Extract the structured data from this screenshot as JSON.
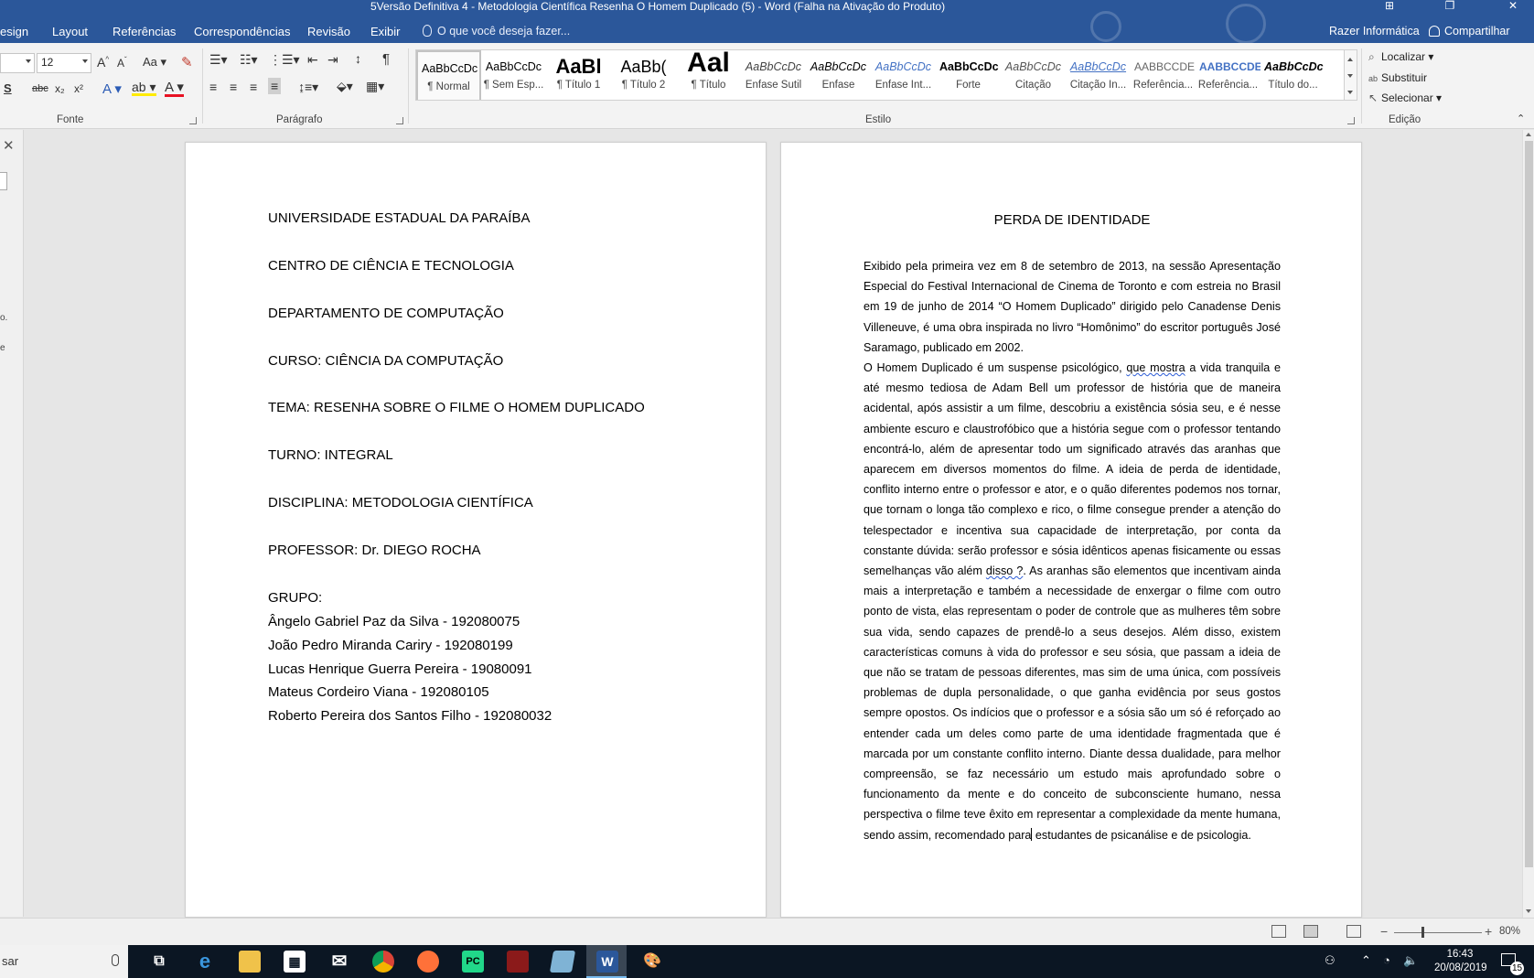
{
  "window": {
    "title": "5Versão Definitiva 4 - Metodologia Científica Resenha O Homem Duplicado (5) - Word (Falha na Ativação do Produto)"
  },
  "menu": {
    "tabs": [
      "esign",
      "Layout",
      "Referências",
      "Correspondências",
      "Revisão",
      "Exibir"
    ],
    "tell_me": "O que você deseja fazer...",
    "user": "Razer Informática",
    "share": "Compartilhar"
  },
  "ribbon": {
    "font_size": "12",
    "font_group": "Fonte",
    "paragraph_group": "Parágrafo",
    "style_group": "Estilo",
    "edit_group": "Edição",
    "styles": [
      {
        "preview": "AaBbCcDc",
        "name": "¶ Normal"
      },
      {
        "preview": "AaBbCcDc",
        "name": "¶ Sem Esp..."
      },
      {
        "preview": "AaBl",
        "name": "¶ Título 1"
      },
      {
        "preview": "AaBb(",
        "name": "¶ Título 2"
      },
      {
        "preview": "Aal",
        "name": "¶ Título"
      },
      {
        "preview": "AaBbCcDc",
        "name": "Ênfase Sutil"
      },
      {
        "preview": "AaBbCcDc",
        "name": "Ênfase"
      },
      {
        "preview": "AaBbCcDc",
        "name": "Ênfase Int..."
      },
      {
        "preview": "AaBbCcDc",
        "name": "Forte"
      },
      {
        "preview": "AaBbCcDc",
        "name": "Citação"
      },
      {
        "preview": "AaBbCcDc",
        "name": "Citação In..."
      },
      {
        "preview": "AABBCCDE",
        "name": "Referência..."
      },
      {
        "preview": "AABBCCDE",
        "name": "Referência..."
      },
      {
        "preview": "AaBbCcDc",
        "name": "Título do..."
      }
    ],
    "find": "Localizar",
    "replace": "Substituir",
    "select": "Selecionar"
  },
  "left_pane": {
    "frag1": "o.",
    "frag2": "e"
  },
  "page1": {
    "lines": [
      "UNIVERSIDADE ESTADUAL DA PARAÍBA",
      "CENTRO DE CIÊNCIA E TECNOLOGIA",
      "DEPARTAMENTO DE COMPUTAÇÃO",
      "CURSO: CIÊNCIA DA COMPUTAÇÃO",
      "TEMA: RESENHA SOBRE O FILME O HOMEM DUPLICADO",
      "TURNO: INTEGRAL",
      "DISCIPLINA: METODOLOGIA CIENTÍFICA",
      "PROFESSOR: Dr. DIEGO ROCHA",
      "GRUPO:",
      "Ângelo Gabriel Paz da Silva - 192080075",
      "João Pedro Miranda Cariry - 192080199",
      "Lucas Henrique Guerra Pereira - 19080091",
      "Mateus Cordeiro Viana - 192080105",
      "Roberto Pereira dos Santos Filho - 192080032"
    ]
  },
  "page2": {
    "title": "PERDA DE IDENTIDADE",
    "para1": "Exibido pela primeira vez em 8 de setembro de 2013, na sessão Apresentação Especial do Festival Internacional de Cinema de Toronto e com estreia no Brasil em 19 de junho de 2014 “O Homem Duplicado” dirigido pelo Canadense Denis Villeneuve, é uma obra inspirada no livro “Homônimo” do escritor português José Saramago, publicado em 2002.",
    "para2_a": "O Homem Duplicado é um suspense psicológico,",
    "para2_sq1": "que  mostra",
    "para2_b": "a vida tranquila e até mesmo tediosa de Adam Bell um professor de história que de maneira acidental, após assistir a um filme, descobriu a existência sósia seu, e é nesse ambiente escuro e claustrofóbico  que   a história segue com o professor tentando encontrá-lo, além de apresentar todo um significado através das aranhas que aparecem em diversos momentos do filme. A ideia de perda de identidade, conflito interno entre o professor e ator, e o quão diferentes podemos nos tornar, que tornam o longa tão complexo e rico, o filme consegue prender a atenção do telespectador e incentiva sua capacidade de interpretação, por conta da constante dúvida: serão professor e sósia idênticos apenas fisicamente ou essas semelhanças vão além",
    "para2_sq2": "disso ?",
    "para2_c": ". As aranhas são elementos que incentivam ainda mais a interpretação e também a necessidade de enxergar o filme com outro ponto de vista, elas representam o poder de controle que as mulheres têm sobre sua vida, sendo capazes de prendê-lo a seus desejos. Além disso, existem características comuns à vida do professor e seu sósia, que passam a ideia de que não se tratam de pessoas diferentes, mas sim de uma única, com possíveis problemas de dupla personalidade, o que ganha evidência por seus gostos sempre opostos. Os indícios que o professor e a sósia são um só é reforçado ao entender cada um deles como parte de uma identidade fragmentada que é marcada por um constante conflito interno. Diante dessa dualidade, para melhor compreensão, se faz necessário um estudo mais aprofundado sobre o funcionamento da mente e do conceito de subconsciente humano, nessa perspectiva o filme teve êxito em representar a complexidade da mente humana, sendo assim, recomendado para",
    "para2_d": "estudantes de psicanálise e de psicologia."
  },
  "status": {
    "zoom": "80%"
  },
  "taskbar": {
    "search": "sar",
    "time": "16:43",
    "date": "20/08/2019",
    "notifications": "15"
  }
}
